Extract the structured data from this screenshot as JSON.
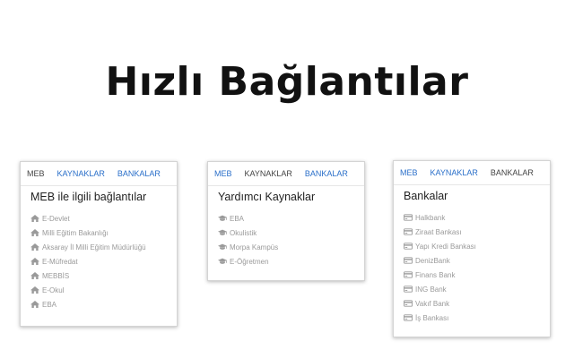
{
  "page_title": "Hızlı Bağlantılar",
  "colors": {
    "accent": "#2a6fc9",
    "muted_text": "#9a9a9a",
    "title_text": "#222222"
  },
  "cards": [
    {
      "tabs": [
        "MEB",
        "KAYNAKLAR",
        "BANKALAR"
      ],
      "active_tab": 0,
      "title": "MEB ile ilgili bağlantılar",
      "icon": "home-icon",
      "items": [
        "E-Devlet",
        "Milli Eğitim Bakanlığı",
        "Aksaray İl Milli Eğitim Müdürlüğü",
        "E-Müfredat",
        "MEBBİS",
        "E-Okul",
        "EBA"
      ]
    },
    {
      "tabs": [
        "MEB",
        "KAYNAKLAR",
        "BANKALAR"
      ],
      "active_tab": 1,
      "title": "Yardımcı Kaynaklar",
      "icon": "graduation-cap-icon",
      "items": [
        "EBA",
        "Okulistik",
        "Morpa Kampüs",
        "E-Öğretmen"
      ]
    },
    {
      "tabs": [
        "MEB",
        "KAYNAKLAR",
        "BANKALAR"
      ],
      "active_tab": 2,
      "title": "Bankalar",
      "icon": "credit-card-icon",
      "items": [
        "Halkbank",
        "Ziraat Bankası",
        "Yapı Kredi Bankası",
        "DenizBank",
        "Finans Bank",
        "ING Bank",
        "Vakıf Bank",
        "İş Bankası"
      ]
    }
  ]
}
